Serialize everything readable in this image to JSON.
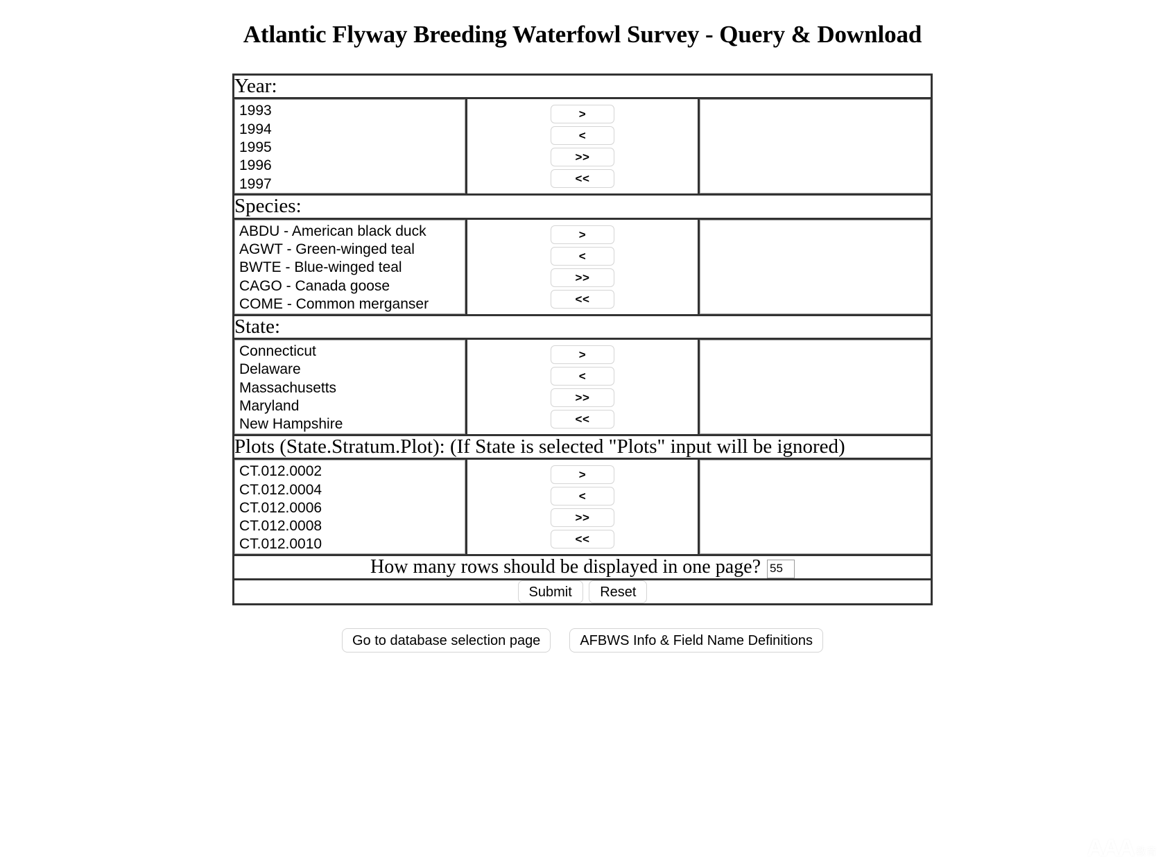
{
  "page": {
    "title": "Atlantic Flyway Breeding Waterfowl Survey - Query & Download"
  },
  "transfer_buttons": {
    "add": ">",
    "remove": "<",
    "add_all": ">>",
    "remove_all": "<<"
  },
  "sections": [
    {
      "key": "year",
      "label": "Year:",
      "available": [
        "1993",
        "1994",
        "1995",
        "1996",
        "1997"
      ],
      "selected": []
    },
    {
      "key": "species",
      "label": "Species:",
      "available": [
        "ABDU - American black duck",
        "AGWT - Green-winged teal",
        "BWTE - Blue-winged teal",
        "CAGO - Canada goose",
        "COME - Common merganser"
      ],
      "selected": []
    },
    {
      "key": "state",
      "label": "State:",
      "available": [
        "Connecticut",
        "Delaware",
        "Massachusetts",
        "Maryland",
        "New Hampshire"
      ],
      "selected": []
    },
    {
      "key": "plots",
      "label": "Plots (State.Stratum.Plot): (If State is selected \"Plots\" input will be ignored)",
      "available": [
        "CT.012.0002",
        "CT.012.0004",
        "CT.012.0006",
        "CT.012.0008",
        "CT.012.0010"
      ],
      "selected": []
    }
  ],
  "rows_per_page": {
    "label": "How many rows should be displayed in one page?",
    "value": "55"
  },
  "actions": {
    "submit": "Submit",
    "reset": "Reset"
  },
  "footer": {
    "database_selection": "Go to database selection page",
    "info_definitions": "AFBWS Info & Field Name Definitions"
  },
  "watermark": {
    "main": "AAA",
    "sub": "教育"
  },
  "colors": {
    "outer_border": "#333333",
    "listbox_border": "#a8a8a8",
    "button_border": "#d4d4d4",
    "text": "#000000",
    "background": "#ffffff"
  }
}
